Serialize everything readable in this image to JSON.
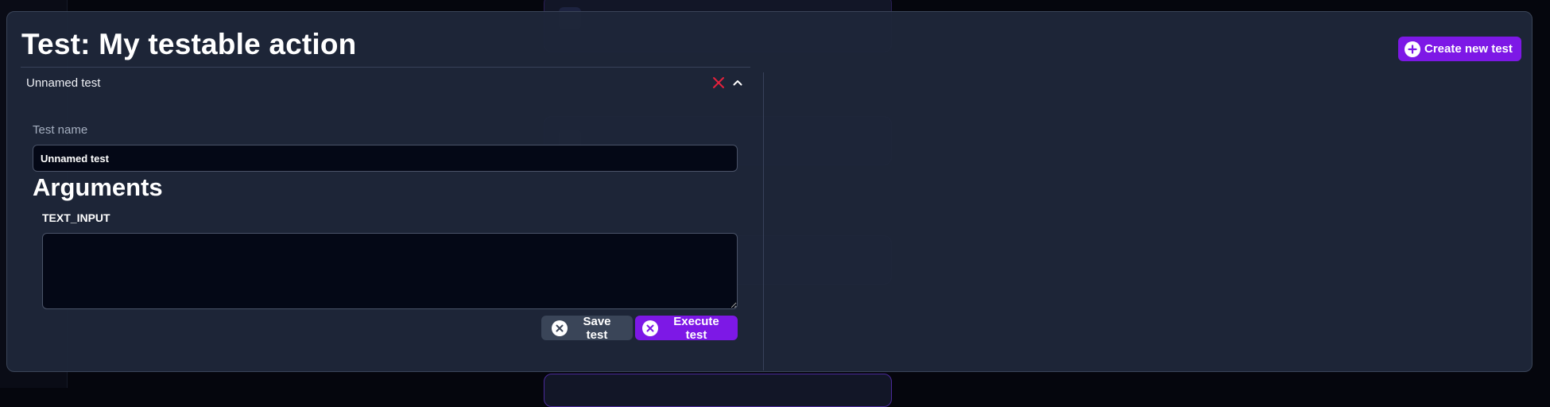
{
  "modal": {
    "title": "Test: My testable action",
    "create_button_label": "Create new test"
  },
  "test_item": {
    "header_title": "Unnamed test",
    "name_label": "Test name",
    "name_value": "Unnamed test",
    "arguments_heading": "Arguments",
    "argument_label": "TEXT_INPUT",
    "argument_value": "",
    "save_button_label": "Save test",
    "execute_button_label": "Execute test"
  },
  "icons": {
    "create": "plus-circle-icon",
    "delete": "close-icon",
    "collapse": "chevron-up-icon",
    "save": "x-circle-icon",
    "execute": "x-circle-icon"
  },
  "colors": {
    "accent": "#7d18e6",
    "danger": "#e5213c",
    "modal_bg": "#1e2639",
    "input_bg": "#040816",
    "secondary_button": "#3a4558"
  }
}
